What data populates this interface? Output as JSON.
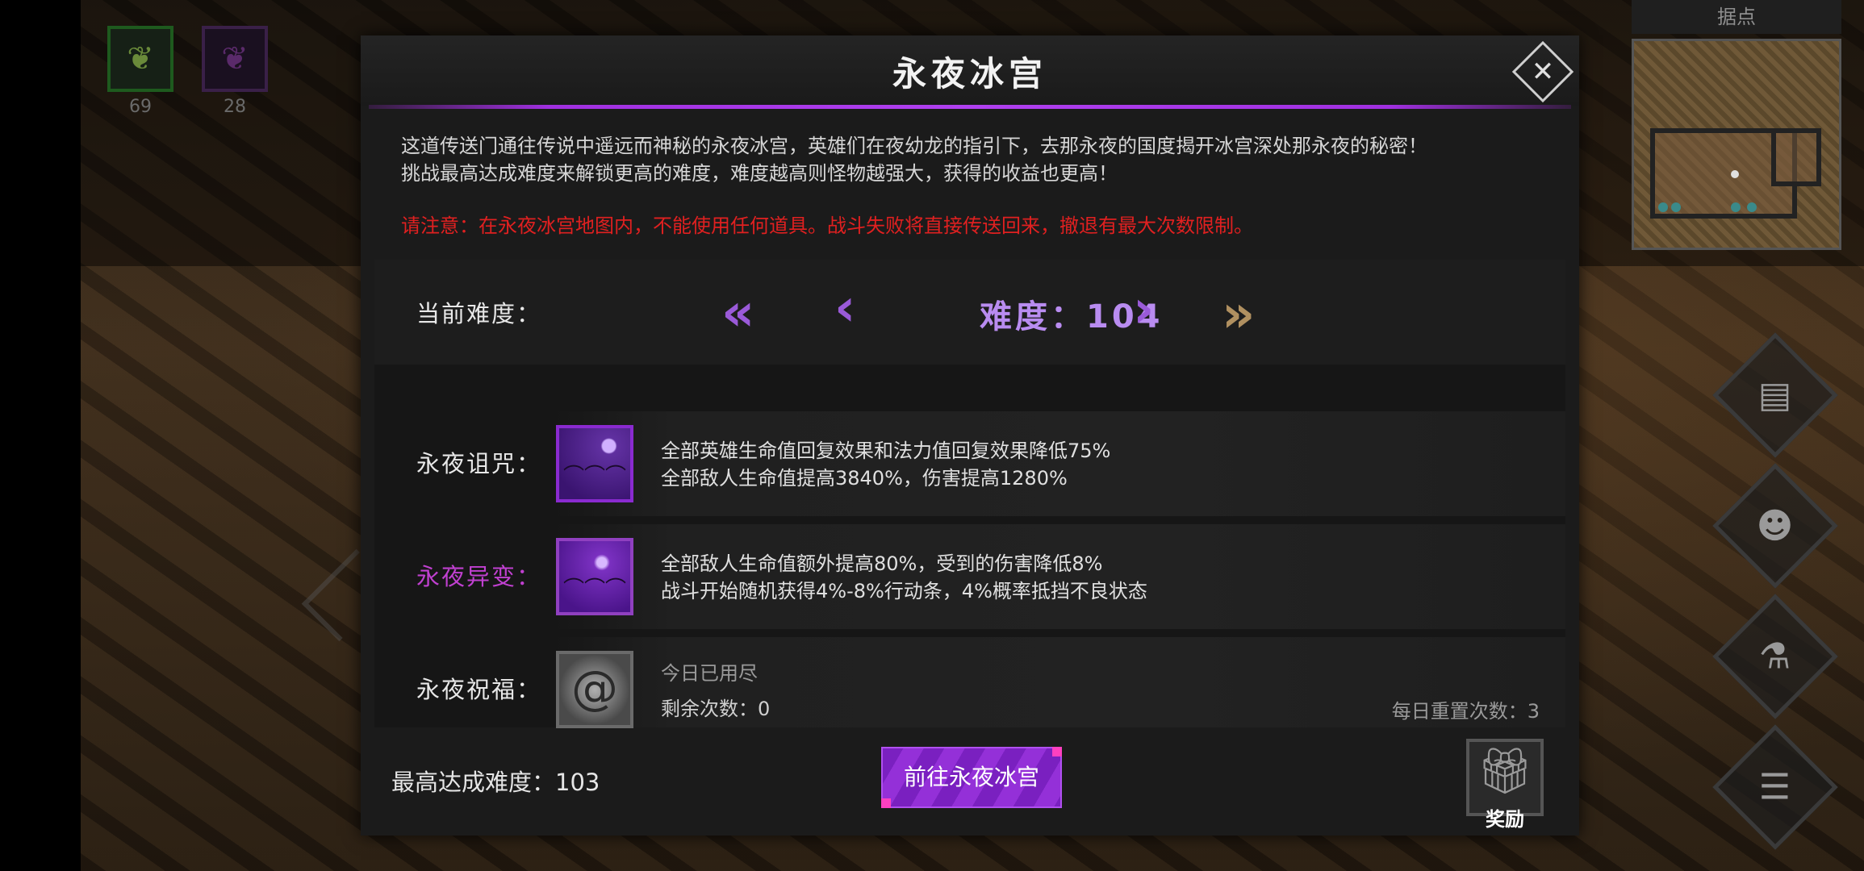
{
  "hud": {
    "inventory": [
      {
        "icon": "green-feather-item-icon",
        "count": "69"
      },
      {
        "icon": "purple-feather-item-icon",
        "count": "28"
      }
    ],
    "minimap": {
      "title": "据点"
    },
    "side_buttons": [
      "scroll-icon",
      "party-icon",
      "potion-icon",
      "menu-list-icon"
    ]
  },
  "dialog": {
    "title": "永夜冰宫",
    "description": [
      "这道传送门通往传说中遥远而神秘的永夜冰宫，英雄们在夜幼龙的指引下，去那永夜的国度揭开冰宫深处那永夜的秘密！",
      "挑战最高达成难度来解锁更高的难度，难度越高则怪物越强大，获得的收益也更高！"
    ],
    "warning": "请注意：在永夜冰宫地图内，不能使用任何道具。战斗失败将直接传送回来，撤退有最大次数限制。",
    "difficulty": {
      "label": "当前难度：",
      "value_text": "难度：104",
      "arrows": {
        "first": "«",
        "prev": "‹",
        "next": "›",
        "last": "»"
      }
    },
    "curse": {
      "label": "永夜诅咒：",
      "lines": [
        "全部英雄生命值回复效果和法力值回复效果降低75%",
        "全部敌人生命值提高3840%，伤害提高1280%"
      ]
    },
    "mutation": {
      "label": "永夜异变：",
      "lines": [
        "全部敌人生命值额外提高80%，受到的伤害降低8%",
        "战斗开始随机获得4%-8%行动条，4%概率抵挡不良状态"
      ]
    },
    "blessing": {
      "label": "永夜祝福：",
      "status": "今日已用尽",
      "remaining": "剩余次数：0",
      "daily_reset": "每日重置次数：3"
    },
    "max_difficulty": "最高达成难度：103",
    "go_button": "前往永夜冰宫",
    "reward_label": "奖励",
    "colors": {
      "accent_purple": "#a030e0",
      "warning_red": "#e02020",
      "difficulty_text": "#b98cf0"
    }
  }
}
